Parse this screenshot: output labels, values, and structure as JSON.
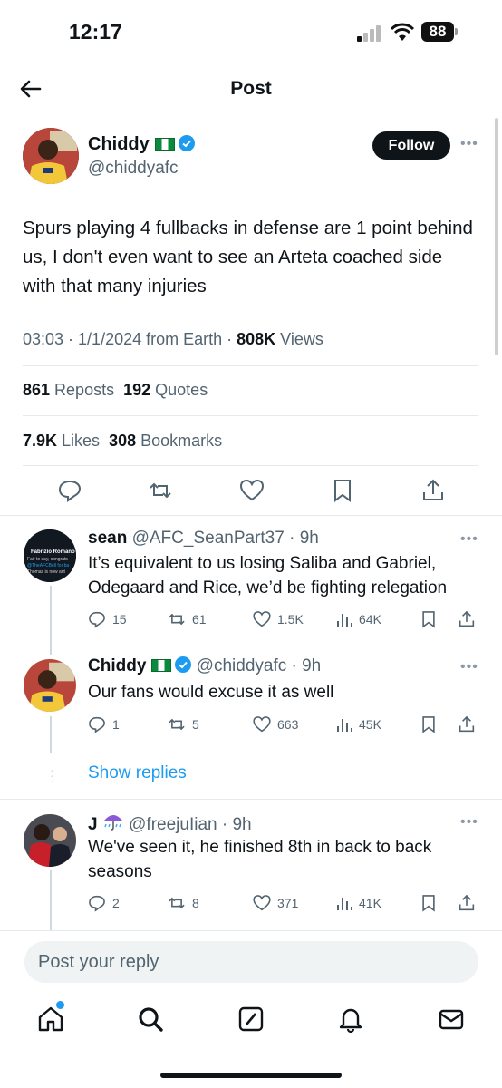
{
  "status_bar": {
    "time": "12:17",
    "battery": "88"
  },
  "header": {
    "title": "Post"
  },
  "tweet": {
    "name": "Chiddy",
    "handle": "@chiddyafc",
    "follow_label": "Follow",
    "text": "Spurs playing 4 fullbacks in defense are 1 point behind us, I don't even want to see an Arteta coached side with that many injuries",
    "timestamp": "03:03 · 1/1/2024 from Earth · ",
    "views_count": "808K",
    "views_label": " Views",
    "reposts_count": "861",
    "reposts_label": " Reposts",
    "quotes_count": "192",
    "quotes_label": " Quotes",
    "likes_count": "7.9K",
    "likes_label": " Likes",
    "bookmarks_count": "308",
    "bookmarks_label": " Bookmarks"
  },
  "replies": [
    {
      "name": "sean",
      "handle": "@AFC_SeanPart37",
      "time": " · 9h",
      "text": "It’s equivalent to us losing Saliba and Gabriel, Odegaard and Rice, we’d be fighting relegation",
      "replies": "15",
      "reposts": "61",
      "likes": "1.5K",
      "views": "64K",
      "avatar_text": [
        "Fabrizio Romano",
        "Fair to say, congrats",
        "@TheAFCBell for ba",
        "Thomas is now arri"
      ]
    },
    {
      "name": "Chiddy",
      "handle": "@chiddyafc",
      "time": " · 9h",
      "text": "Our fans would excuse it as well",
      "replies": "1",
      "reposts": "5",
      "likes": "663",
      "views": "45K"
    },
    {
      "name": "J",
      "handle": "@freejuIian",
      "time": " · 9h",
      "text": "We've seen it, he finished 8th in back to back seasons",
      "replies": "2",
      "reposts": "8",
      "likes": "371",
      "views": "41K"
    }
  ],
  "show_replies": "Show replies",
  "reply_placeholder": "Post your reply",
  "colors": {
    "accent": "#1d9bf0",
    "text": "#0f1419",
    "muted": "#536471",
    "flag_green": "#0a8a3c"
  },
  "icons": [
    "back-arrow-icon",
    "verified-icon",
    "reply-icon",
    "repost-icon",
    "like-icon",
    "views-icon",
    "bookmark-icon",
    "share-icon",
    "home-icon",
    "search-icon",
    "grok-icon",
    "notifications-icon",
    "messages-icon"
  ]
}
